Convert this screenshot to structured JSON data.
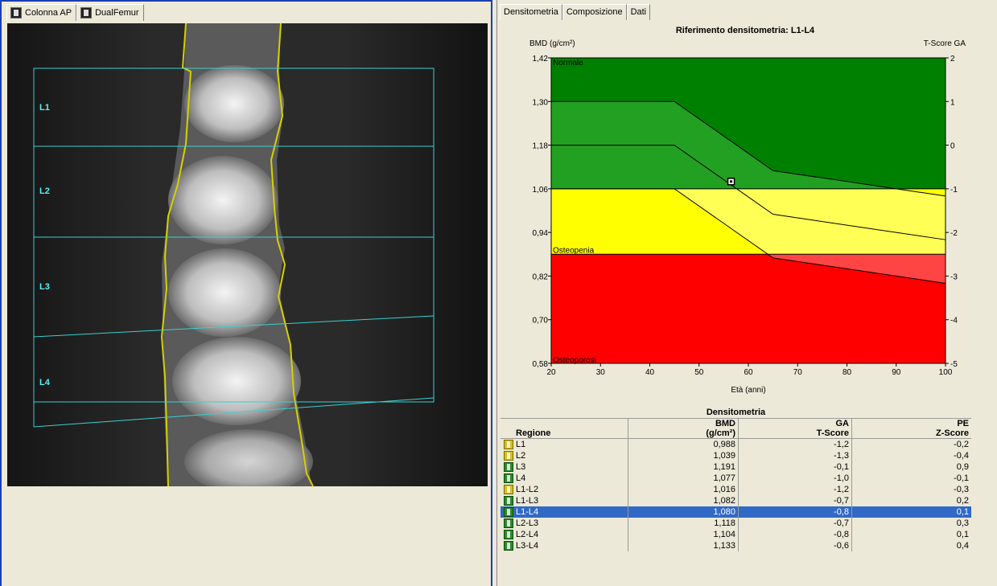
{
  "left_tabs": [
    {
      "label": "Colonna AP",
      "icon": "spine-icon"
    },
    {
      "label": "DualFemur",
      "icon": "femur-icon"
    }
  ],
  "scan": {
    "region_labels": [
      "L1",
      "L2",
      "L3",
      "L4"
    ]
  },
  "right_tabs": [
    "Densitometria",
    "Composizione",
    "Dati"
  ],
  "chart_data": {
    "type": "area",
    "title": "Riferimento densitometria: L1-L4",
    "ylabel": "BMD (g/cm²)",
    "y2label": "T-Score GA",
    "xlabel": "Età (anni)",
    "xlim": [
      20,
      100
    ],
    "ylim": [
      0.58,
      1.42
    ],
    "x_ticks": [
      "20",
      "30",
      "40",
      "50",
      "60",
      "70",
      "80",
      "90",
      "100"
    ],
    "y_ticks": [
      "1,42",
      "1,30",
      "1,18",
      "1,06",
      "0,94",
      "0,82",
      "0,70",
      "0,58"
    ],
    "y2_ticks": [
      "2",
      "1",
      "0",
      "-1",
      "-2",
      "-3",
      "-4",
      "-5"
    ],
    "zones": [
      {
        "name": "Normale",
        "from": 1.06,
        "to": 1.42,
        "color": "#008000"
      },
      {
        "name": "Osteopenia",
        "from": 0.88,
        "to": 1.06,
        "color": "#ffff00"
      },
      {
        "name": "Osteoporosi",
        "from": 0.58,
        "to": 0.88,
        "color": "#ff0000"
      }
    ],
    "reference_lines": [
      {
        "x": [
          20,
          45,
          65,
          100
        ],
        "y": [
          1.3,
          1.3,
          1.11,
          1.04
        ]
      },
      {
        "x": [
          20,
          45,
          65,
          100
        ],
        "y": [
          1.18,
          1.18,
          0.99,
          0.92
        ]
      },
      {
        "x": [
          20,
          45,
          65,
          100
        ],
        "y": [
          1.06,
          1.06,
          0.87,
          0.8
        ]
      }
    ],
    "patient_point": {
      "x": 56.5,
      "y": 1.08
    }
  },
  "table": {
    "title": "Densitometria",
    "headers": [
      {
        "line1": "",
        "line2": "Regione"
      },
      {
        "line1": "BMD",
        "line2": "(g/cm²)"
      },
      {
        "line1": "GA",
        "line2": "T-Score"
      },
      {
        "line1": "PE",
        "line2": "Z-Score"
      }
    ],
    "rows": [
      {
        "region": "L1",
        "bmd": "0,988",
        "t": "-1,2",
        "z": "-0,2",
        "icon": "yellow"
      },
      {
        "region": "L2",
        "bmd": "1,039",
        "t": "-1,3",
        "z": "-0,4",
        "icon": "yellow"
      },
      {
        "region": "L3",
        "bmd": "1,191",
        "t": "-0,1",
        "z": "0,9",
        "icon": "green"
      },
      {
        "region": "L4",
        "bmd": "1,077",
        "t": "-1,0",
        "z": "-0,1",
        "icon": "green"
      },
      {
        "region": "L1-L2",
        "bmd": "1,016",
        "t": "-1,2",
        "z": "-0,3",
        "icon": "yellow"
      },
      {
        "region": "L1-L3",
        "bmd": "1,082",
        "t": "-0,7",
        "z": "0,2",
        "icon": "green"
      },
      {
        "region": "L1-L4",
        "bmd": "1,080",
        "t": "-0,8",
        "z": "0,1",
        "icon": "green",
        "selected": true
      },
      {
        "region": "L2-L3",
        "bmd": "1,118",
        "t": "-0,7",
        "z": "0,3",
        "icon": "green"
      },
      {
        "region": "L2-L4",
        "bmd": "1,104",
        "t": "-0,8",
        "z": "0,1",
        "icon": "green"
      },
      {
        "region": "L3-L4",
        "bmd": "1,133",
        "t": "-0,6",
        "z": "0,4",
        "icon": "green"
      }
    ]
  }
}
